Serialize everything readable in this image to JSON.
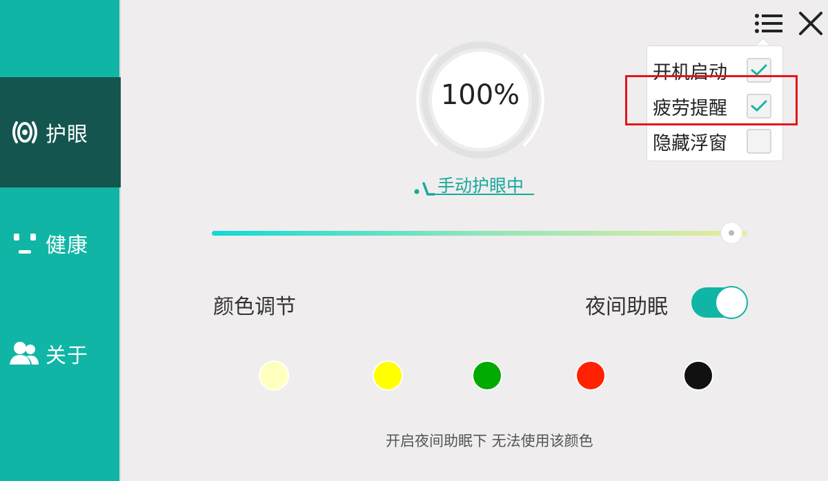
{
  "sidebar": {
    "items": [
      {
        "label": "护眼",
        "icon": "eye-icon",
        "active": true
      },
      {
        "label": "健康",
        "icon": "face-icon",
        "active": false
      },
      {
        "label": "关于",
        "icon": "users-icon",
        "active": false
      }
    ]
  },
  "header": {
    "menu_icon": "list-menu-icon",
    "close_icon": "close-icon"
  },
  "gauge": {
    "value_text": "100%",
    "percent": 100
  },
  "mode": {
    "label": "手动护眼中"
  },
  "brightness": {
    "percent": 97
  },
  "color": {
    "label": "颜色调节",
    "swatches": [
      "#ffffc0",
      "#ffff00",
      "#00aa00",
      "#ff2200",
      "#111111"
    ]
  },
  "night_mode": {
    "label": "夜间助眠",
    "enabled": true
  },
  "note": "开启夜间助眠下 无法使用该颜色",
  "menu": {
    "items": [
      {
        "label": "开机启动",
        "checked": true
      },
      {
        "label": "疲劳提醒",
        "checked": true
      },
      {
        "label": "隐藏浮窗",
        "checked": false
      }
    ]
  },
  "colors": {
    "accent": "#10b5a5",
    "active_nav": "#14564f",
    "highlight": "#e2141b"
  }
}
